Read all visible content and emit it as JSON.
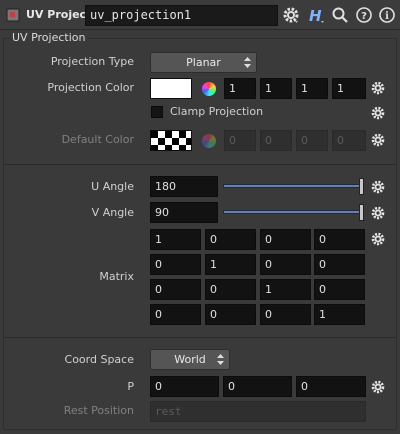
{
  "header": {
    "node_type": "UV Project",
    "node_name": "uv_projection1"
  },
  "folder": {
    "title": "UV Projection"
  },
  "projection_type": {
    "label": "Projection Type",
    "value": "Planar"
  },
  "projection_color": {
    "label": "Projection Color",
    "color": "#ffffff",
    "values": [
      "1",
      "1",
      "1",
      "1"
    ]
  },
  "clamp_projection": {
    "label": "Clamp Projection",
    "checked": false
  },
  "default_color": {
    "label": "Default Color",
    "values": [
      "0",
      "0",
      "0",
      "0"
    ]
  },
  "u_angle": {
    "label": "U Angle",
    "value": "180",
    "slider_fraction": 1.0
  },
  "v_angle": {
    "label": "V Angle",
    "value": "90",
    "slider_fraction": 1.0
  },
  "matrix": {
    "label": "Matrix",
    "rows": [
      [
        "1",
        "0",
        "0",
        "0"
      ],
      [
        "0",
        "1",
        "0",
        "0"
      ],
      [
        "0",
        "0",
        "1",
        "0"
      ],
      [
        "0",
        "0",
        "0",
        "1"
      ]
    ]
  },
  "coord_space": {
    "label": "Coord Space",
    "value": "World"
  },
  "p": {
    "label": "P",
    "values": [
      "0",
      "0",
      "0"
    ]
  },
  "rest_position": {
    "label": "Rest Position",
    "placeholder": "rest"
  },
  "icons": {
    "gear": "gear-icon",
    "help": "help-icon",
    "info": "info-icon",
    "search": "search-icon",
    "houdini": "houdini-logo-icon"
  }
}
